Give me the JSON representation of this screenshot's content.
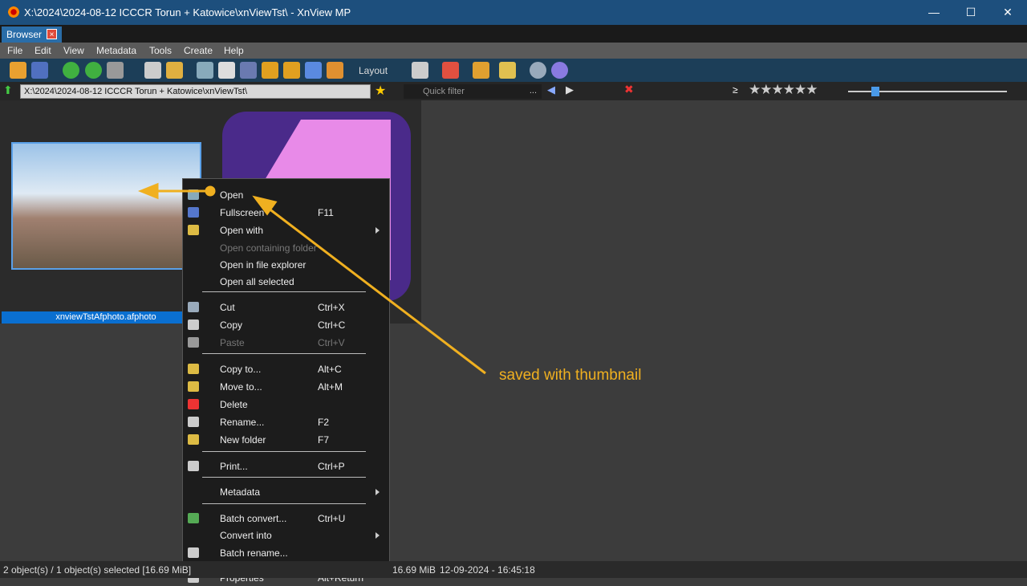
{
  "window": {
    "title": "X:\\2024\\2024-08-12 ICCCR Torun + Katowice\\xnViewTst\\ - XnView MP",
    "minimize": "—",
    "maximize": "☐",
    "close": "✕"
  },
  "tab": {
    "label": "Browser",
    "close": "×"
  },
  "menu": [
    "File",
    "Edit",
    "View",
    "Metadata",
    "Tools",
    "Create",
    "Help"
  ],
  "toolbar": {
    "layout": "Layout"
  },
  "address": {
    "path": "X:\\2024\\2024-08-12 ICCCR Torun + Katowice\\xnViewTst\\",
    "quick_filter_placeholder": "Quick filter",
    "more": "...",
    "ge": "≥"
  },
  "files": [
    {
      "name": "xnviewTstAfphoto.afphoto"
    }
  ],
  "context_menu": [
    {
      "label": "Open",
      "shortcut": ""
    },
    {
      "label": "Fullscreen",
      "shortcut": "F11"
    },
    {
      "label": "Open with",
      "shortcut": "",
      "submenu": true
    },
    {
      "label": "Open containing folder",
      "shortcut": "",
      "disabled": true
    },
    {
      "label": "Open in file explorer",
      "shortcut": ""
    },
    {
      "label": "Open all selected",
      "shortcut": ""
    },
    {
      "label": "Cut",
      "shortcut": "Ctrl+X"
    },
    {
      "label": "Copy",
      "shortcut": "Ctrl+C"
    },
    {
      "label": "Paste",
      "shortcut": "Ctrl+V",
      "disabled": true
    },
    {
      "label": "Copy to...",
      "shortcut": "Alt+C"
    },
    {
      "label": "Move to...",
      "shortcut": "Alt+M"
    },
    {
      "label": "Delete",
      "shortcut": ""
    },
    {
      "label": "Rename...",
      "shortcut": "F2"
    },
    {
      "label": "New folder",
      "shortcut": "F7"
    },
    {
      "label": "Print...",
      "shortcut": "Ctrl+P"
    },
    {
      "label": "Metadata",
      "shortcut": "",
      "submenu": true
    },
    {
      "label": "Batch convert...",
      "shortcut": "Ctrl+U"
    },
    {
      "label": "Convert into",
      "shortcut": "",
      "submenu": true
    },
    {
      "label": "Batch rename...",
      "shortcut": ""
    },
    {
      "label": "Properties",
      "shortcut": "Alt+Return"
    }
  ],
  "status": {
    "objects": "2 object(s) / 1 object(s) selected [16.69 MiB]",
    "size": "16.69 MiB",
    "date": "12-09-2024 - 16:45:18"
  },
  "annotation": {
    "text": "saved with thumbnail",
    "color": "#f0b020"
  }
}
